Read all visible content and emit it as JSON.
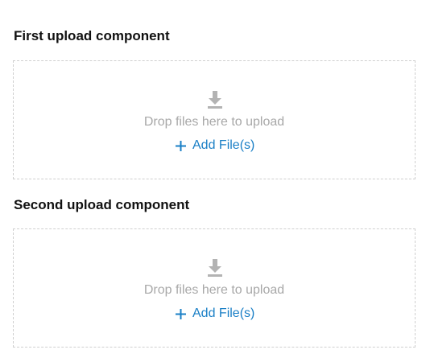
{
  "sections": [
    {
      "title": "First upload component",
      "drop_text": "Drop files here to upload",
      "add_label": "Add File(s)",
      "icon": "download-arrow-icon"
    },
    {
      "title": "Second upload component",
      "drop_text": "Drop files here to upload",
      "add_label": "Add File(s)",
      "icon": "download-arrow-icon"
    }
  ],
  "colors": {
    "title": "#111111",
    "dropzone_border": "#cfcfcf",
    "drop_text": "#a8a8a8",
    "icon": "#b3b3b3",
    "accent": "#1a7fc6"
  }
}
